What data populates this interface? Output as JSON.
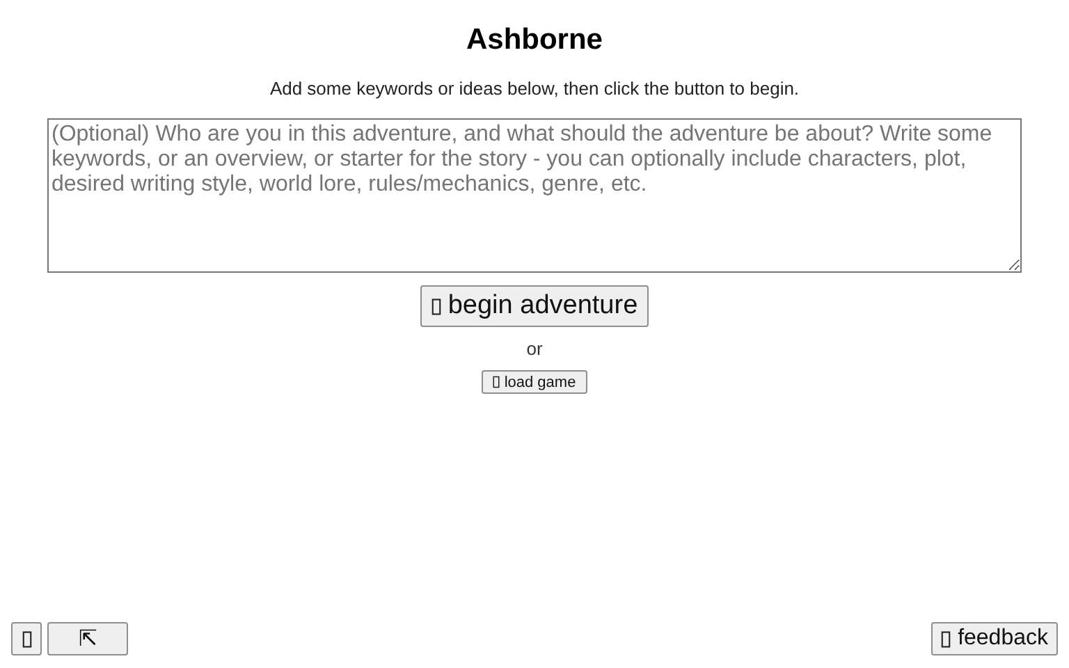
{
  "title": "Ashborne",
  "subtitle": "Add some keywords or ideas below, then click the button to begin.",
  "prompt": {
    "placeholder": "(Optional) Who are you in this adventure, and what should the adventure be about? Write some keywords, or an overview, or starter for the story - you can optionally include characters, plot, desired writing style, world lore, rules/mechanics, genre, etc."
  },
  "begin_button": "begin adventure",
  "separator": "or",
  "load_button": "load game",
  "bottom_left": [
    {
      "kind": "icon"
    },
    {
      "kind": "text",
      "label": "⇱"
    }
  ],
  "feedback_button": "feedback"
}
